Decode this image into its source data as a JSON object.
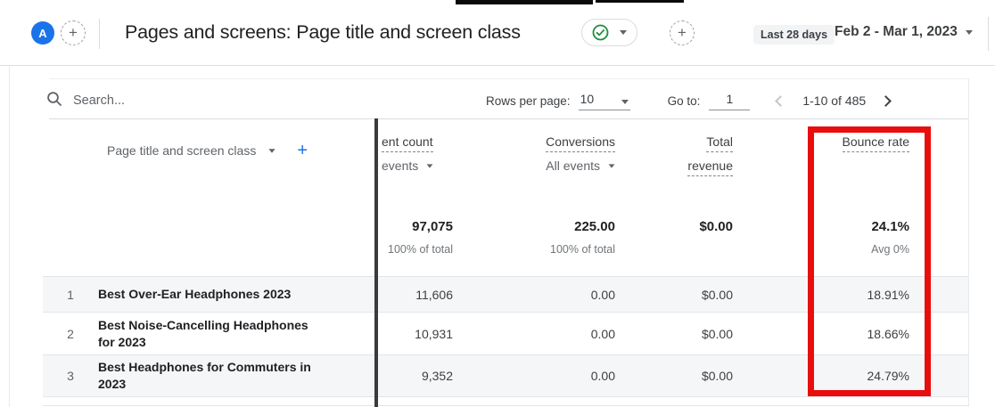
{
  "colors": {
    "accent_blue": "#1a73e8",
    "check_green": "#1e8e3e",
    "highlight_red": "#e90e0e"
  },
  "icons": {
    "plus": "+"
  },
  "header": {
    "avatar_label": "A",
    "title": "Pages and screens: Page title and screen class",
    "date_range_badge": "Last 28 days",
    "date_range": "Feb 2 - Mar 1, 2023"
  },
  "toolbar": {
    "search_placeholder": "Search...",
    "rows_per_page_label": "Rows per page:",
    "rows_per_page_value": "10",
    "goto_label": "Go to:",
    "goto_value": "1",
    "pagination_range": "1-10 of 485"
  },
  "table": {
    "dimension_header": "Page title and screen class",
    "columns": {
      "event_count_line1": "ent count",
      "event_count_line2": "events",
      "conversions_line1": "Conversions",
      "conversions_line2": "All events",
      "total_revenue_line1": "Total",
      "total_revenue_line2": "revenue",
      "bounce_rate": "Bounce rate"
    },
    "totals": {
      "event_count": "97,075",
      "event_count_sub": "100% of total",
      "conversions": "225.00",
      "conversions_sub": "100% of total",
      "total_revenue": "$0.00",
      "bounce_rate": "24.1%",
      "bounce_rate_sub": "Avg 0%"
    },
    "rows": [
      {
        "num": "1",
        "title": "Best Over-Ear Headphones 2023",
        "event_count": "11,606",
        "conversions": "0.00",
        "total_revenue": "$0.00",
        "bounce_rate": "18.91%"
      },
      {
        "num": "2",
        "title": "Best Noise-Cancelling Headphones for 2023",
        "event_count": "10,931",
        "conversions": "0.00",
        "total_revenue": "$0.00",
        "bounce_rate": "18.66%"
      },
      {
        "num": "3",
        "title": "Best Headphones for Commuters in 2023",
        "event_count": "9,352",
        "conversions": "0.00",
        "total_revenue": "$0.00",
        "bounce_rate": "24.79%"
      }
    ]
  }
}
